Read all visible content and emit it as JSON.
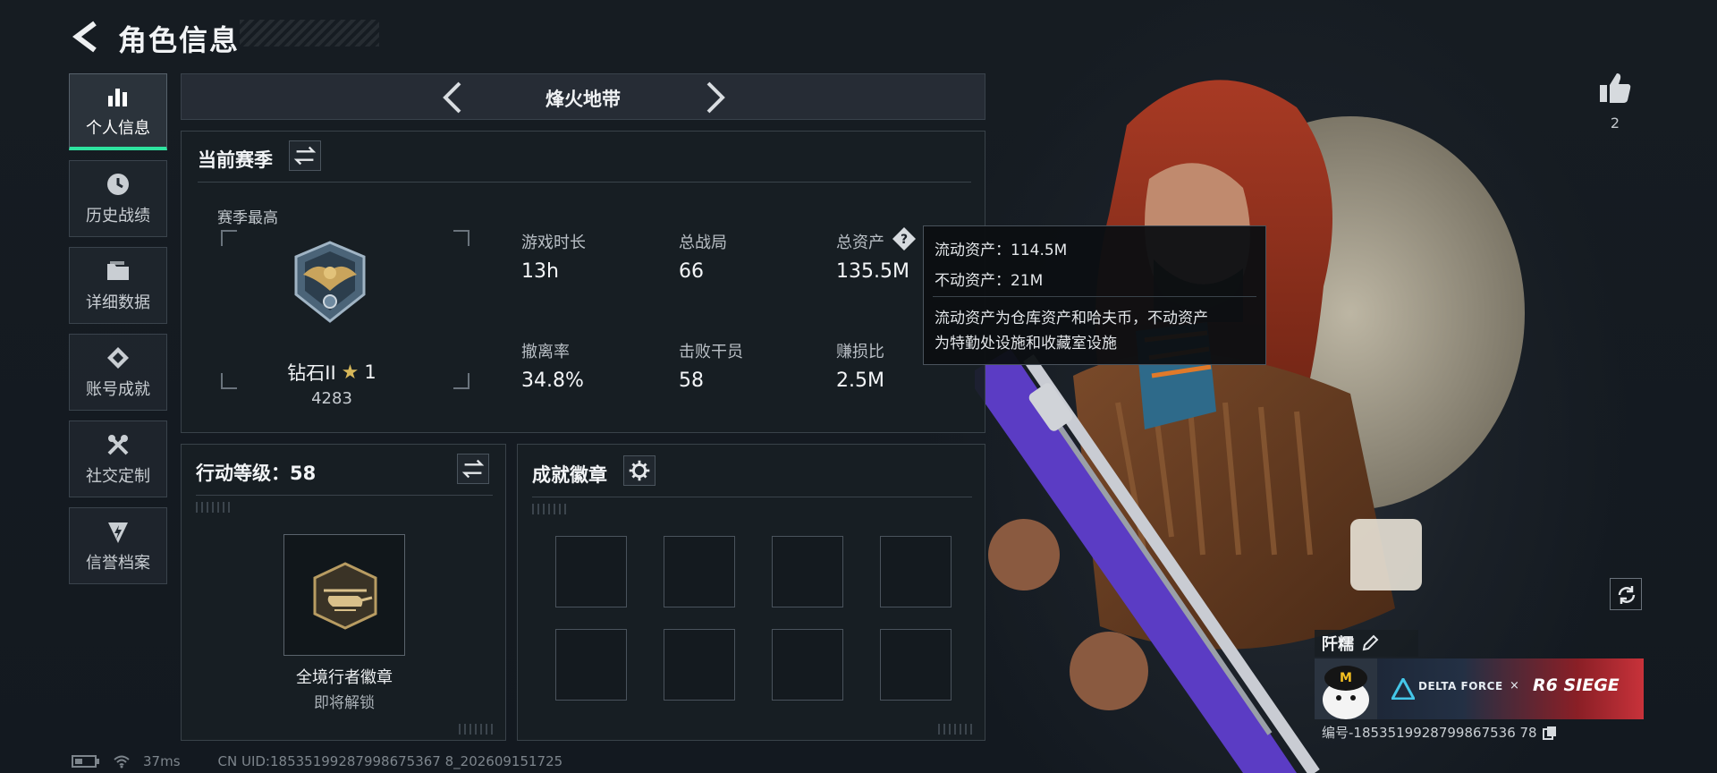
{
  "header": {
    "title": "角色信息"
  },
  "nav": {
    "items": [
      {
        "label": "个人信息",
        "active": true
      },
      {
        "label": "历史战绩",
        "active": false
      },
      {
        "label": "详细数据",
        "active": false
      },
      {
        "label": "账号成就",
        "active": false
      },
      {
        "label": "社交定制",
        "active": false
      },
      {
        "label": "信誉档案",
        "active": false
      }
    ]
  },
  "mode_selector": {
    "current": "烽火地带"
  },
  "season_panel": {
    "title": "当前赛季",
    "highest_label": "赛季最高",
    "rank_name": "钻石II",
    "rank_stars": "1",
    "rank_points": "4283",
    "stats": [
      {
        "label": "游戏时长",
        "value": "13h"
      },
      {
        "label": "总战局",
        "value": "66"
      },
      {
        "label": "总资产",
        "value": "135.5M"
      },
      {
        "label": "撤离率",
        "value": "34.8%"
      },
      {
        "label": "击败干员",
        "value": "58"
      },
      {
        "label": "赚损比",
        "value": "2.5M"
      }
    ]
  },
  "tooltip": {
    "liquid": "流动资产：114.5M",
    "fixed": "不动资产：21M",
    "desc_line1": "流动资产为仓库资产和哈夫币，不动资产",
    "desc_line2": "为特勤处设施和收藏室设施"
  },
  "action_panel": {
    "title": "行动等级：58",
    "badge_name": "全境行者徽章",
    "badge_status": "即将解锁"
  },
  "achievement_panel": {
    "title": "成就徽章"
  },
  "likes": {
    "count": "2"
  },
  "player_card": {
    "name": "阡糯",
    "brand": "DELTA FORCE",
    "cross": "×",
    "collab": "R6 SIEGE",
    "id_text": "编号-1853519928799867536 78"
  },
  "status_bar": {
    "ping": "37ms",
    "uid": "CN UID:18535199287998675367 8_202609151725"
  },
  "colors": {
    "accent": "#2ee3a0",
    "tooltip_bg": "#0c0f12",
    "collab_red": "#c8323a"
  }
}
